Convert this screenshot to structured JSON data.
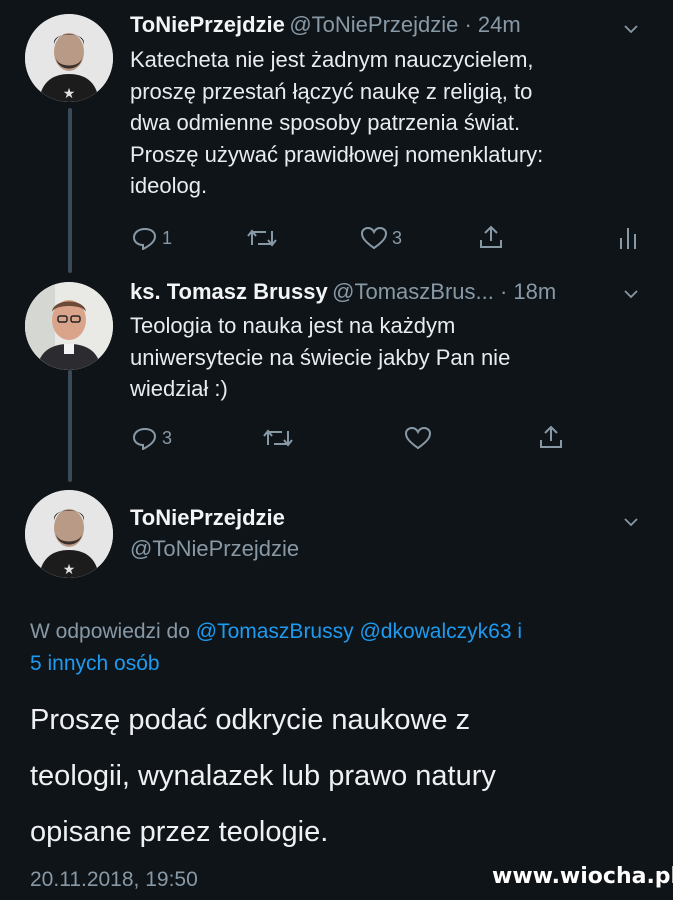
{
  "tweet1": {
    "name": "ToNiePrzejdzie",
    "handle_time": "@ToNiePrzejdzie · 24m",
    "lines": [
      "Katecheta nie jest żadnym nauczycielem,",
      "proszę przestań łączyć naukę z religią, to",
      "dwa odmienne sposoby patrzenia świat.",
      "Proszę używać prawidłowej nomenklatury:",
      "ideolog."
    ],
    "reply_count": "1",
    "retweet_count": "",
    "like_count": "3"
  },
  "tweet2": {
    "name": "ks. Tomasz Brussy",
    "handle_time": "@TomaszBrus... · 18m",
    "lines": [
      "Teologia to nauka jest na każdym",
      "uniwersytecie na świecie jakby Pan nie",
      "wiedział :)"
    ],
    "reply_count": "3",
    "like_count": ""
  },
  "main": {
    "name": "ToNiePrzejdzie",
    "handle": "@ToNiePrzejdzie",
    "reply_prefix": "W odpowiedzi do ",
    "reply_links_line1": "@TomaszBrussy @dkowalczyk63 i",
    "reply_links_line2": "5 innych osób",
    "lines": [
      "Proszę podać odkrycie naukowe z",
      "teologii, wynalazek lub prawo natury",
      "opisane przez teologie."
    ],
    "date": "20.11.2018, 19:50"
  },
  "watermark": "www.wiocha.pl",
  "icons": [
    "reply-icon",
    "retweet-icon",
    "like-icon",
    "share-icon",
    "analytics-icon",
    "chevron-down-icon"
  ],
  "colors": {
    "background": "#0f1419",
    "muted": "#8899a6",
    "link": "#1d9bf0",
    "thread_line": "#3b4a58"
  }
}
